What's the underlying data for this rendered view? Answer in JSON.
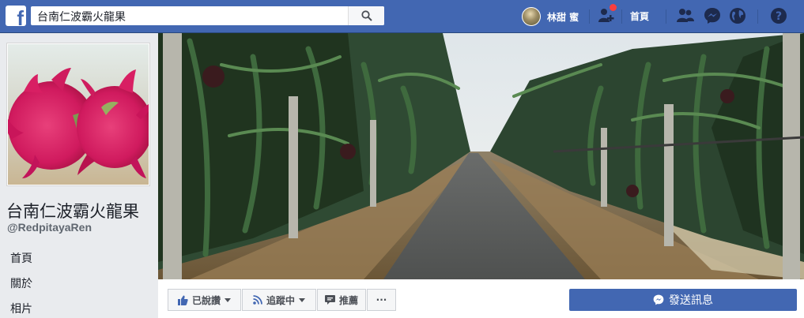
{
  "topbar": {
    "search_value": "台南仁波霸火龍果",
    "user_name": "林甜 蜜",
    "home_label": "首頁",
    "colors": {
      "bar": "#4267b2",
      "badge": "#fa3e3e"
    },
    "icons": [
      "facebook-logo-icon",
      "search-icon",
      "friend-requests-icon",
      "friends-icon",
      "messenger-icon",
      "globe-icon",
      "help-icon"
    ]
  },
  "page": {
    "title": "台南仁波霸火龍果",
    "handle": "@RedpitayaRen",
    "nav": [
      {
        "label": "首頁"
      },
      {
        "label": "關於"
      },
      {
        "label": "相片"
      }
    ]
  },
  "actions": {
    "like": "已說讚",
    "follow": "追蹤中",
    "share": "推薦",
    "more": "···",
    "send_message": "發送訊息",
    "accent": "#4267b2"
  }
}
